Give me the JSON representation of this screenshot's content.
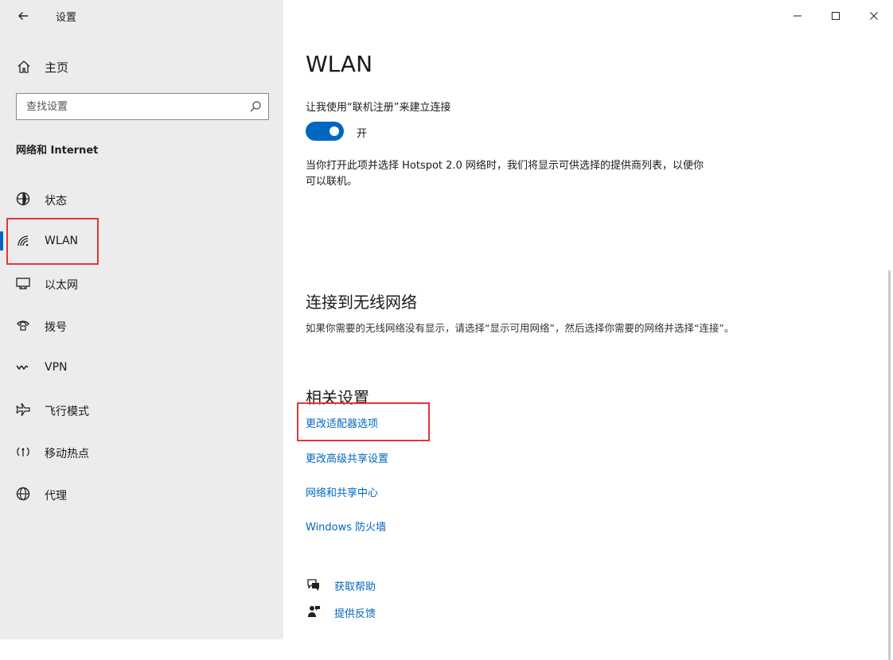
{
  "window": {
    "title": "设置",
    "controls": {
      "minimize": "minimize",
      "maximize": "maximize",
      "close": "close"
    }
  },
  "sidebar": {
    "home_label": "主页",
    "search_placeholder": "查找设置",
    "section_label": "网络和 Internet",
    "items": [
      {
        "label": "状态",
        "icon": "globe-status-icon"
      },
      {
        "label": "WLAN",
        "icon": "wifi-icon",
        "active": true
      },
      {
        "label": "以太网",
        "icon": "ethernet-icon"
      },
      {
        "label": "拨号",
        "icon": "dialup-icon"
      },
      {
        "label": "VPN",
        "icon": "vpn-icon"
      },
      {
        "label": "飞行模式",
        "icon": "airplane-icon"
      },
      {
        "label": "移动热点",
        "icon": "hotspot-icon"
      },
      {
        "label": "代理",
        "icon": "globe-proxy-icon"
      }
    ]
  },
  "main": {
    "title": "WLAN",
    "online_signup_label": "让我使用“联机注册”来建立连接",
    "toggle_state": "开",
    "description": "当你打开此项并选择 Hotspot 2.0 网络时，我们将显示可供选择的提供商列表，以便你可以联机。",
    "connect_heading": "连接到无线网络",
    "connect_description": "如果你需要的无线网络没有显示，请选择“显示可用网络”，然后选择你需要的网络并选择“连接”。",
    "related_heading": "相关设置",
    "related_links": [
      "更改适配器选项",
      "更改高级共享设置",
      "网络和共享中心",
      "Windows 防火墙"
    ],
    "help_links": [
      {
        "label": "获取帮助",
        "icon": "help-chat-icon"
      },
      {
        "label": "提供反馈",
        "icon": "feedback-icon"
      }
    ]
  },
  "colors": {
    "accent": "#0067c0",
    "annotation": "#e53535",
    "sidebar_bg": "#ececec"
  }
}
